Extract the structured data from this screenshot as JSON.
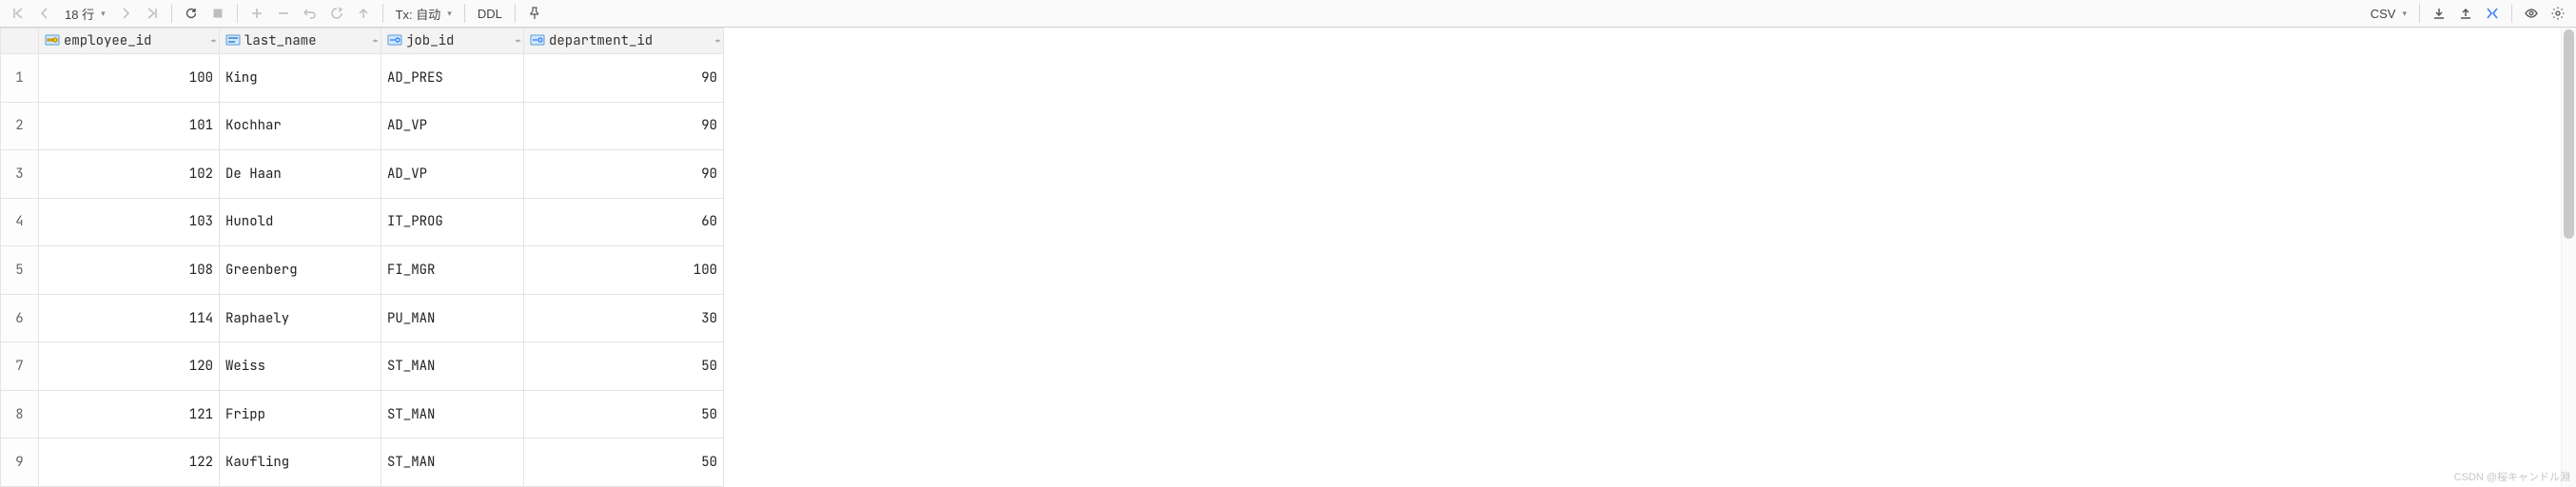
{
  "toolbar": {
    "rows_label": "18 行",
    "tx_label": "Tx: 自动",
    "ddl_label": "DDL",
    "csv_label": "CSV"
  },
  "columns": [
    {
      "name": "employee_id",
      "align": "num",
      "icon": "pk",
      "cls": "col-emp"
    },
    {
      "name": "last_name",
      "align": "txt",
      "icon": "col",
      "cls": "col-last"
    },
    {
      "name": "job_id",
      "align": "txt",
      "icon": "fk",
      "cls": "col-job"
    },
    {
      "name": "department_id",
      "align": "num",
      "icon": "fk",
      "cls": "col-dept"
    }
  ],
  "rows": [
    {
      "employee_id": 100,
      "last_name": "King",
      "job_id": "AD_PRES",
      "department_id": 90
    },
    {
      "employee_id": 101,
      "last_name": "Kochhar",
      "job_id": "AD_VP",
      "department_id": 90
    },
    {
      "employee_id": 102,
      "last_name": "De Haan",
      "job_id": "AD_VP",
      "department_id": 90
    },
    {
      "employee_id": 103,
      "last_name": "Hunold",
      "job_id": "IT_PROG",
      "department_id": 60
    },
    {
      "employee_id": 108,
      "last_name": "Greenberg",
      "job_id": "FI_MGR",
      "department_id": 100
    },
    {
      "employee_id": 114,
      "last_name": "Raphaely",
      "job_id": "PU_MAN",
      "department_id": 30
    },
    {
      "employee_id": 120,
      "last_name": "Weiss",
      "job_id": "ST_MAN",
      "department_id": 50
    },
    {
      "employee_id": 121,
      "last_name": "Fripp",
      "job_id": "ST_MAN",
      "department_id": 50
    },
    {
      "employee_id": 122,
      "last_name": "Kaufling",
      "job_id": "ST_MAN",
      "department_id": 50
    }
  ],
  "watermark": "CSDN @桜キャンドル淵"
}
